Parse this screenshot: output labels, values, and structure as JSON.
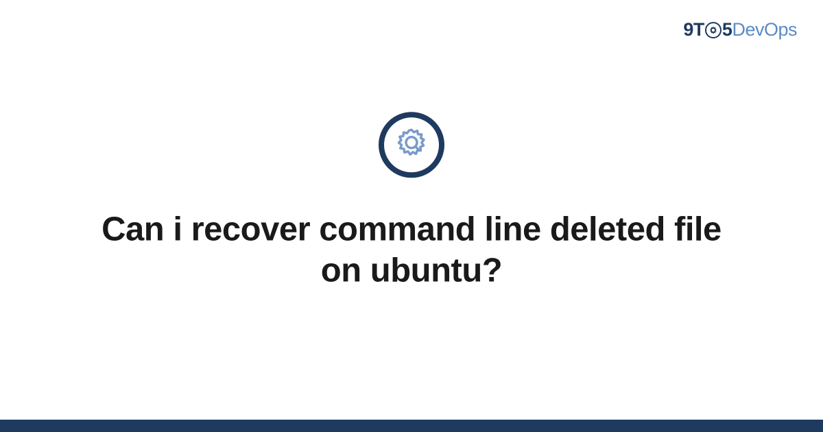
{
  "logo": {
    "part1": "9T",
    "part2": "5",
    "part3": "DevOps"
  },
  "heading": "Can i recover command line deleted file on ubuntu?",
  "colors": {
    "primary_dark": "#1e3a5f",
    "accent_blue": "#5a8bc4",
    "gear_light": "#7a9bc9"
  }
}
